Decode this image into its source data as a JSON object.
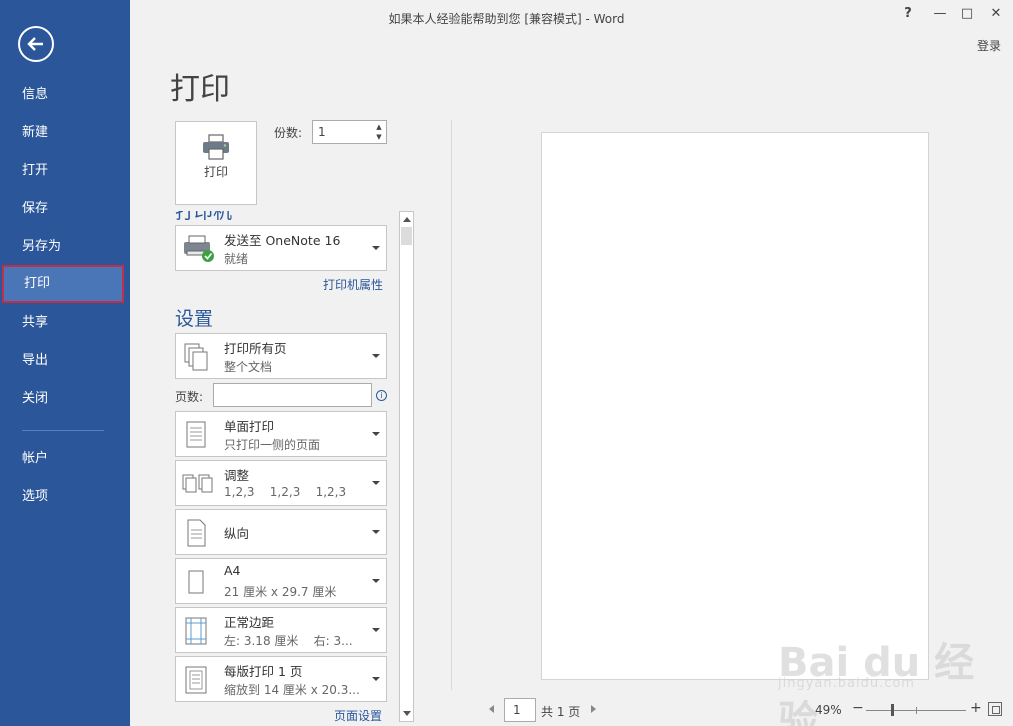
{
  "window": {
    "title": "如果本人经验能帮助到您 [兼容模式] - Word",
    "signin": "登录",
    "help": "?",
    "minimize": "—",
    "restore": "□",
    "close": "✕"
  },
  "sidebar": {
    "items": [
      {
        "label": "信息"
      },
      {
        "label": "新建"
      },
      {
        "label": "打开"
      },
      {
        "label": "保存"
      },
      {
        "label": "另存为"
      },
      {
        "label": "打印"
      },
      {
        "label": "共享"
      },
      {
        "label": "导出"
      },
      {
        "label": "关闭"
      },
      {
        "label": "帐户"
      },
      {
        "label": "选项"
      }
    ],
    "active": "打印"
  },
  "page_title": "打印",
  "print_button": {
    "label": "打印"
  },
  "copies": {
    "label": "份数:",
    "value": "1"
  },
  "printer": {
    "heading": "打印机",
    "name": "发送至 OneNote 16",
    "status": "就绪",
    "properties_link": "打印机属性"
  },
  "settings": {
    "heading": "设置",
    "print_range": {
      "title": "打印所有页",
      "subtitle": "整个文档"
    },
    "pages_label": "页数:",
    "pages_value": "",
    "sides": {
      "title": "单面打印",
      "subtitle": "只打印一侧的页面"
    },
    "collate": {
      "title": "调整",
      "subtitle": "1,2,3    1,2,3    1,2,3"
    },
    "orientation": {
      "title": "纵向"
    },
    "paper": {
      "title": "A4",
      "subtitle": "21 厘米 x 29.7 厘米"
    },
    "margins": {
      "title": "正常边距",
      "subtitle": "左: 3.18 厘米    右: 3..."
    },
    "per_sheet": {
      "title": "每版打印 1 页",
      "subtitle": "缩放到 14 厘米 x 20.3..."
    },
    "page_setup_link": "页面设置"
  },
  "preview": {
    "current_page": "1",
    "total": "共 1 页",
    "zoom": "49%"
  },
  "watermark": {
    "logo": "Bai du 经验",
    "url": "jingyan.baidu.com"
  },
  "colors": {
    "sidebar": "#2b579a",
    "active_item": "#4a75b7",
    "active_border": "#c0304a",
    "background": "#f1f1f1"
  }
}
